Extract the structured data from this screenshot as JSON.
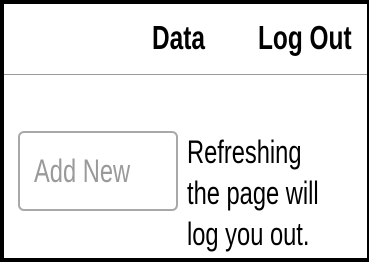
{
  "nav": {
    "data_label": "Data",
    "logout_label": "Log Out"
  },
  "actions": {
    "add_new_label": "Add New",
    "add_new_enabled": false
  },
  "notice": {
    "lines": [
      "Refreshing",
      "the page will",
      "log you out."
    ]
  }
}
